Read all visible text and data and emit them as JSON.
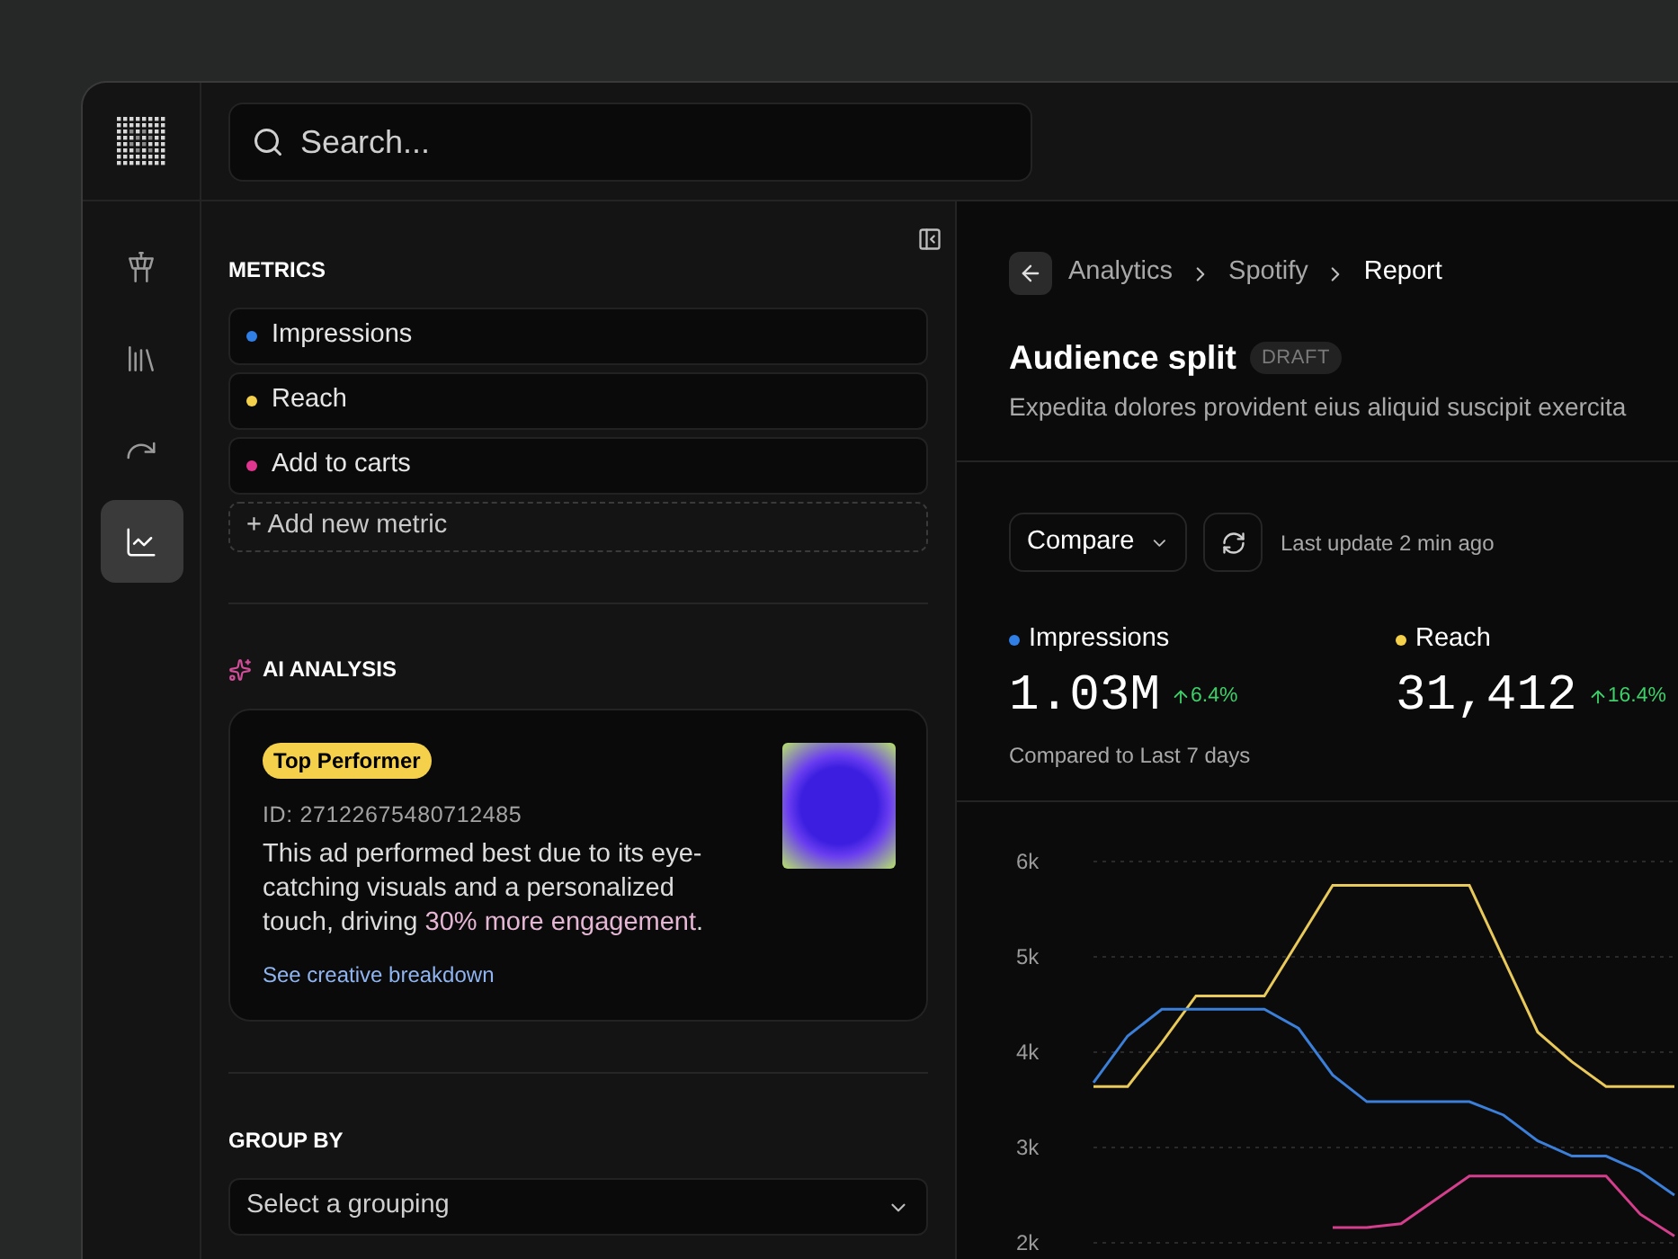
{
  "search": {
    "placeholder": "Search..."
  },
  "rail": {
    "items": [
      {
        "kind": "tower",
        "selected": false
      },
      {
        "kind": "library",
        "selected": false
      },
      {
        "kind": "redo",
        "selected": false
      },
      {
        "kind": "chart",
        "selected": true
      }
    ]
  },
  "metrics": {
    "title": "METRICS",
    "items": [
      {
        "label": "Impressions",
        "color": "#2f7fe6"
      },
      {
        "label": "Reach",
        "color": "#f5d04a"
      },
      {
        "label": "Add to carts",
        "color": "#e0368f"
      }
    ],
    "add_button": "+ Add new metric"
  },
  "ai_analysis": {
    "title": "AI ANALYSIS",
    "card": {
      "badge": "Top Performer",
      "id": "ID: 27122675480712485",
      "text_before": "This ad performed best due to its eye-catching visuals and a personalized touch, driving ",
      "highlight": "30% more engagement",
      "text_after": ".",
      "link": "See creative breakdown"
    }
  },
  "group_by": {
    "title": "GROUP BY",
    "placeholder": "Select a grouping"
  },
  "breadcrumb": [
    {
      "label": "Analytics",
      "current": false
    },
    {
      "label": "Spotify",
      "current": false
    },
    {
      "label": "Report",
      "current": true
    }
  ],
  "report": {
    "title": "Audience split",
    "badge": "DRAFT",
    "description": "Expedita dolores provident eius aliquid suscipit exercita"
  },
  "toolbar": {
    "compare": "Compare",
    "last_update": "Last update 2 min ago"
  },
  "stats": [
    {
      "label": "Impressions",
      "color": "#2f7fe6",
      "value": "1.03M",
      "change": "6.4%",
      "note": "Compared to Last 7 days"
    },
    {
      "label": "Reach",
      "color": "#f5d04a",
      "value": "31,412",
      "change": "16.4%"
    }
  ],
  "chart_data": {
    "type": "line",
    "grid": true,
    "ylim": [
      2000,
      6000
    ],
    "yticks": [
      {
        "value": 2000,
        "label": "2k"
      },
      {
        "value": 3000,
        "label": "3k"
      },
      {
        "value": 4000,
        "label": "4k"
      },
      {
        "value": 5000,
        "label": "5k"
      },
      {
        "value": 6000,
        "label": "6k"
      }
    ],
    "series": [
      {
        "color": "#e8c95a",
        "values": [
          3640,
          3640,
          4100,
          4590,
          4590,
          4590,
          5170,
          5750,
          5750,
          5750,
          5750,
          5750,
          4980,
          4210,
          3900,
          3640,
          3640,
          3640
        ]
      },
      {
        "color": "#3b7fd9",
        "values": [
          3680,
          4170,
          4450,
          4450,
          4450,
          4450,
          4250,
          3760,
          3480,
          3480,
          3480,
          3480,
          3340,
          3070,
          2910,
          2910,
          2750,
          2500
        ]
      },
      {
        "color": "#d43f8d",
        "values": [
          null,
          null,
          null,
          null,
          null,
          null,
          null,
          2160,
          2160,
          2200,
          2450,
          2700,
          2700,
          2700,
          2700,
          2700,
          2300,
          2070
        ]
      }
    ]
  }
}
